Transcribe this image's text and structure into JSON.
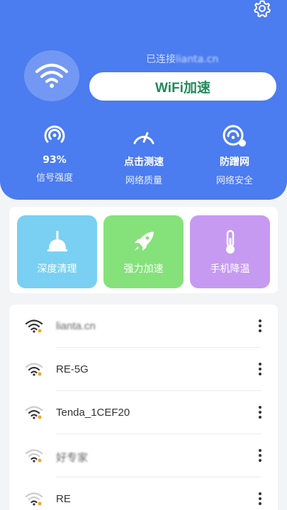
{
  "header": {
    "connected_prefix": "已连接",
    "connected_network": "lianta.cn",
    "boost_label": "WiFi加速",
    "stats": [
      {
        "value": "93%",
        "label": "信号强度",
        "icon": "signal-icon"
      },
      {
        "value": "点击测速",
        "label": "网络质量",
        "icon": "speedometer-icon"
      },
      {
        "value": "防蹭网",
        "label": "网络安全",
        "icon": "shield-wifi-icon"
      }
    ]
  },
  "tools": [
    {
      "label": "深度清理",
      "icon": "broom-icon",
      "color": "#7ad0f2"
    },
    {
      "label": "强力加速",
      "icon": "rocket-icon",
      "color": "#85e27a"
    },
    {
      "label": "手机降温",
      "icon": "thermometer-icon",
      "color": "#c79af2"
    }
  ],
  "networks": [
    {
      "name": "lianta.cn"
    },
    {
      "name": "RE-5G"
    },
    {
      "name": "Tenda_1CEF20"
    },
    {
      "name": "好专家"
    },
    {
      "name": "RE"
    }
  ],
  "colors": {
    "header_bg": "#4b7cf0",
    "boost_text": "#1f8a5b"
  }
}
